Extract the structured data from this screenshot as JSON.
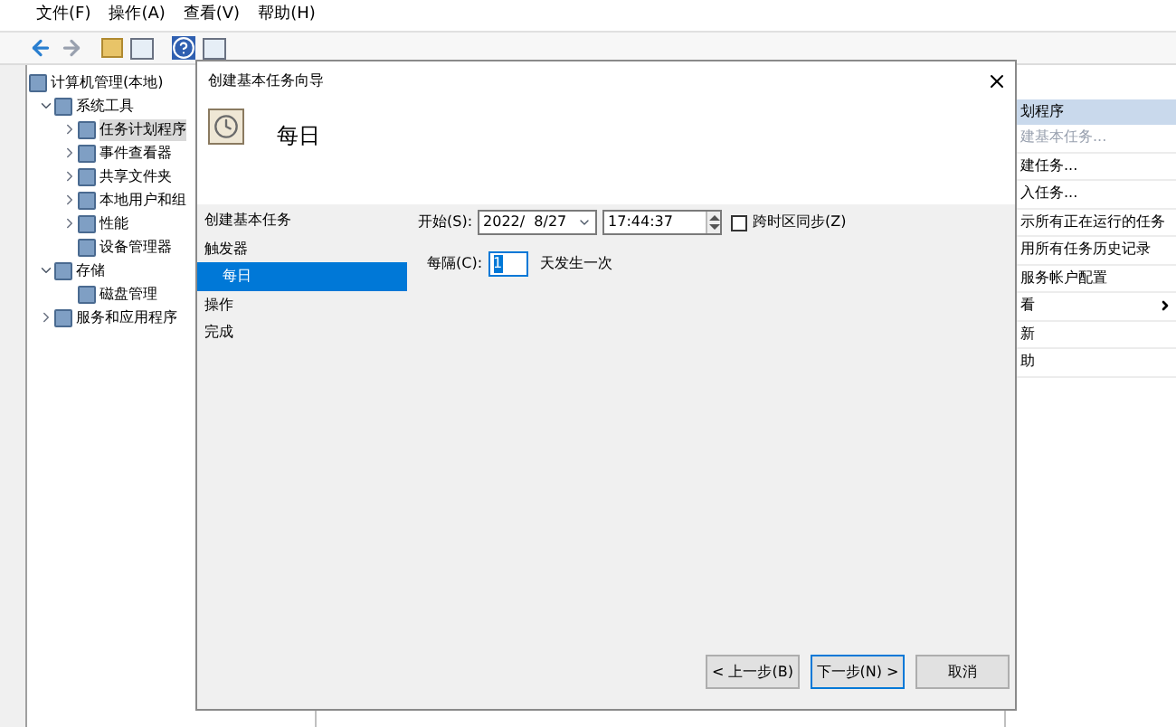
{
  "menu": [
    "文件(F)",
    "操作(A)",
    "查看(V)",
    "帮助(H)"
  ],
  "tree": [
    {
      "label": "计算机管理(本地)",
      "selected": false,
      "children": [
        {
          "label": "系统工具",
          "expanded": true,
          "selected": false,
          "children": [
            {
              "label": "任务计划程序",
              "expanded": false,
              "selected": true
            },
            {
              "label": "事件查看器",
              "expanded": false,
              "selected": false
            },
            {
              "label": "共享文件夹",
              "expanded": false,
              "selected": false
            },
            {
              "label": "本地用户和组",
              "expanded": false,
              "selected": false
            },
            {
              "label": "性能",
              "expanded": false,
              "selected": false
            },
            {
              "label": "设备管理器",
              "selected": false
            }
          ]
        },
        {
          "label": "存储",
          "expanded": true,
          "selected": false,
          "children": [
            {
              "label": "磁盘管理",
              "selected": false
            }
          ]
        },
        {
          "label": "服务和应用程序",
          "expanded": false,
          "selected": false
        }
      ]
    }
  ],
  "actions": [
    {
      "kind": "header",
      "label": "划程序"
    },
    {
      "kind": "item",
      "label": "建基本任务...",
      "disabled": true
    },
    {
      "kind": "item",
      "label": "建任务...",
      "disabled": false
    },
    {
      "kind": "item",
      "label": "入任务...",
      "disabled": false
    },
    {
      "kind": "item",
      "label": "示所有正在运行的任务",
      "disabled": false
    },
    {
      "kind": "item",
      "label": "用所有任务历史记录",
      "disabled": false
    },
    {
      "kind": "item",
      "label": "服务帐户配置",
      "disabled": false
    },
    {
      "kind": "submenu",
      "label": "看",
      "disabled": false
    },
    {
      "kind": "item",
      "label": "新",
      "disabled": false
    },
    {
      "kind": "item",
      "label": "助",
      "disabled": false
    }
  ],
  "dialog": {
    "title": "创建基本任务向导",
    "heading": "每日",
    "steps": [
      {
        "label": "创建基本任务",
        "selected": false,
        "sub": false
      },
      {
        "label": "触发器",
        "selected": false,
        "sub": false
      },
      {
        "label": "每日",
        "selected": true,
        "sub": true
      },
      {
        "label": "操作",
        "selected": false,
        "sub": false
      },
      {
        "label": "完成",
        "selected": false,
        "sub": false
      }
    ],
    "start_label": "开始(S):",
    "date": "2022/  8/27",
    "time": "17:44:37",
    "sync": {
      "label": "跨时区同步(Z)",
      "checked": false
    },
    "recur_label": "每隔(C):",
    "recur_value": "1",
    "recur_suffix": "天发生一次",
    "buttons": [
      {
        "label": "< 上一步(B)",
        "default": false
      },
      {
        "label": "下一步(N) >",
        "default": true
      },
      {
        "label": "取消",
        "default": false
      }
    ]
  }
}
